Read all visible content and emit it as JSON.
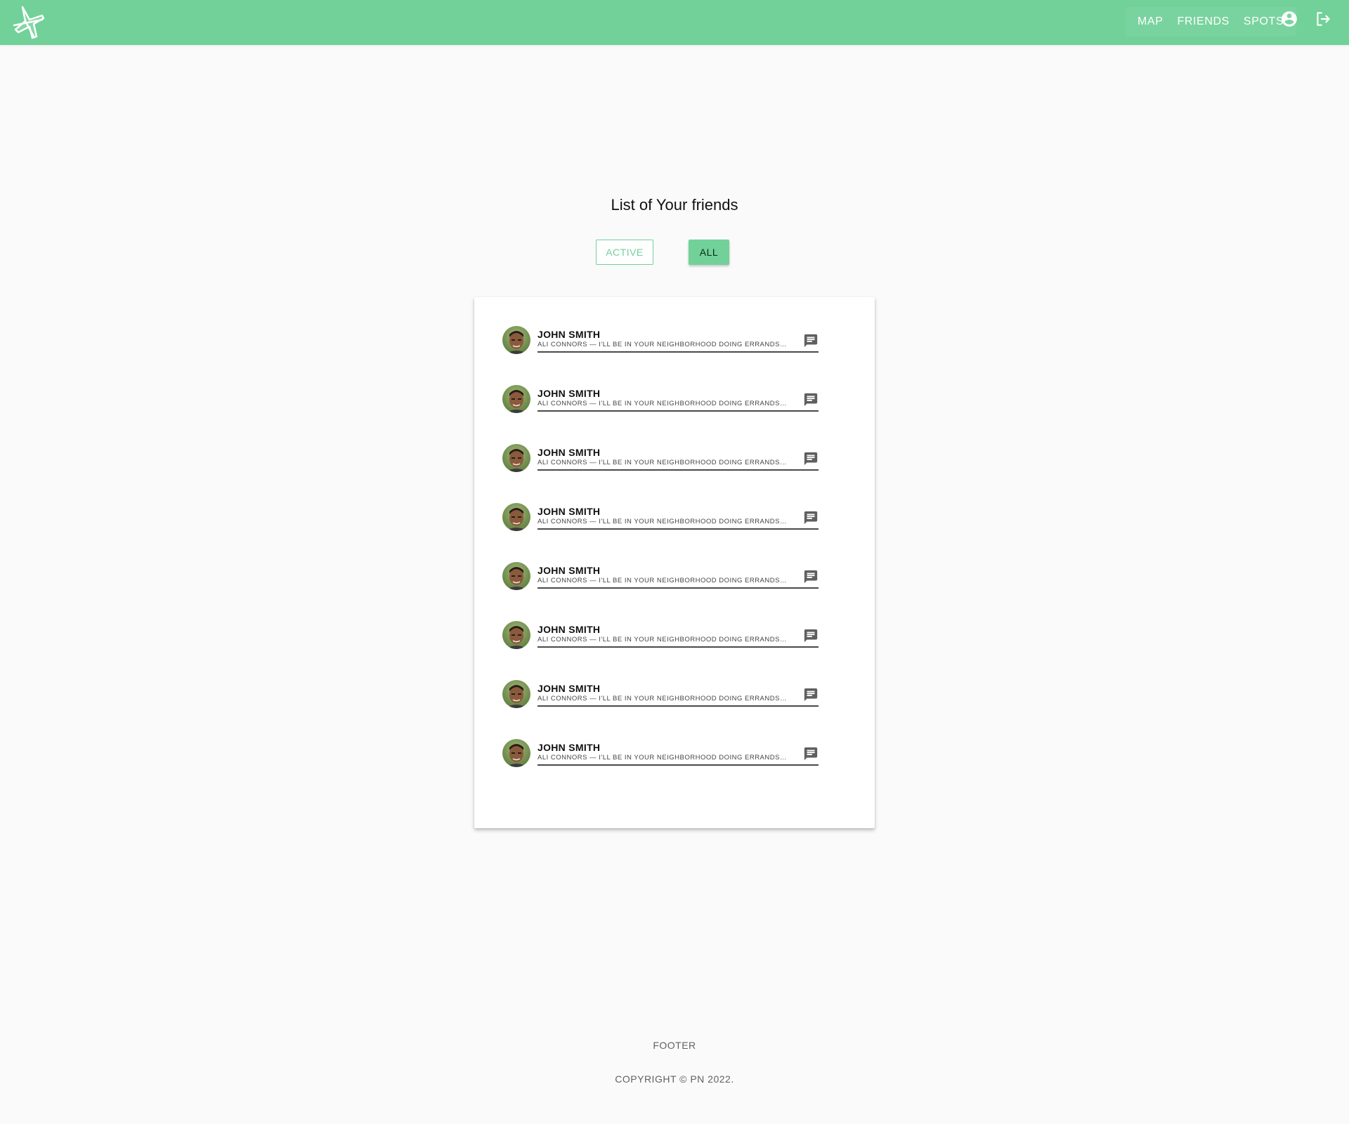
{
  "header": {
    "brand_color": "#71d198",
    "nav": [
      {
        "label": "MAP"
      },
      {
        "label": "FRIENDS"
      },
      {
        "label": "SPOTS"
      }
    ],
    "icons": [
      "logo-icon",
      "account-circle-icon",
      "logout-icon"
    ]
  },
  "main": {
    "title": "List of Your friends",
    "filters": {
      "active_label": "ACTIVE",
      "all_label": "ALL",
      "selected": "ALL"
    },
    "friends": [
      {
        "name": "JOHN SMITH",
        "message": "ALI CONNORS — I'LL BE IN YOUR NEIGHBORHOOD DOING ERRANDS THIS…"
      },
      {
        "name": "JOHN SMITH",
        "message": "ALI CONNORS — I'LL BE IN YOUR NEIGHBORHOOD DOING ERRANDS THIS…"
      },
      {
        "name": "JOHN SMITH",
        "message": "ALI CONNORS — I'LL BE IN YOUR NEIGHBORHOOD DOING ERRANDS THIS…"
      },
      {
        "name": "JOHN SMITH",
        "message": "ALI CONNORS — I'LL BE IN YOUR NEIGHBORHOOD DOING ERRANDS THIS…"
      },
      {
        "name": "JOHN SMITH",
        "message": "ALI CONNORS — I'LL BE IN YOUR NEIGHBORHOOD DOING ERRANDS THIS…"
      },
      {
        "name": "JOHN SMITH",
        "message": "ALI CONNORS — I'LL BE IN YOUR NEIGHBORHOOD DOING ERRANDS THIS…"
      },
      {
        "name": "JOHN SMITH",
        "message": "ALI CONNORS — I'LL BE IN YOUR NEIGHBORHOOD DOING ERRANDS THIS…"
      },
      {
        "name": "JOHN SMITH",
        "message": "ALI CONNORS — I'LL BE IN YOUR NEIGHBORHOOD DOING ERRANDS THIS…"
      }
    ]
  },
  "footer": {
    "title": "FOOTER",
    "copyright": "COPYRIGHT © PN 2022."
  }
}
